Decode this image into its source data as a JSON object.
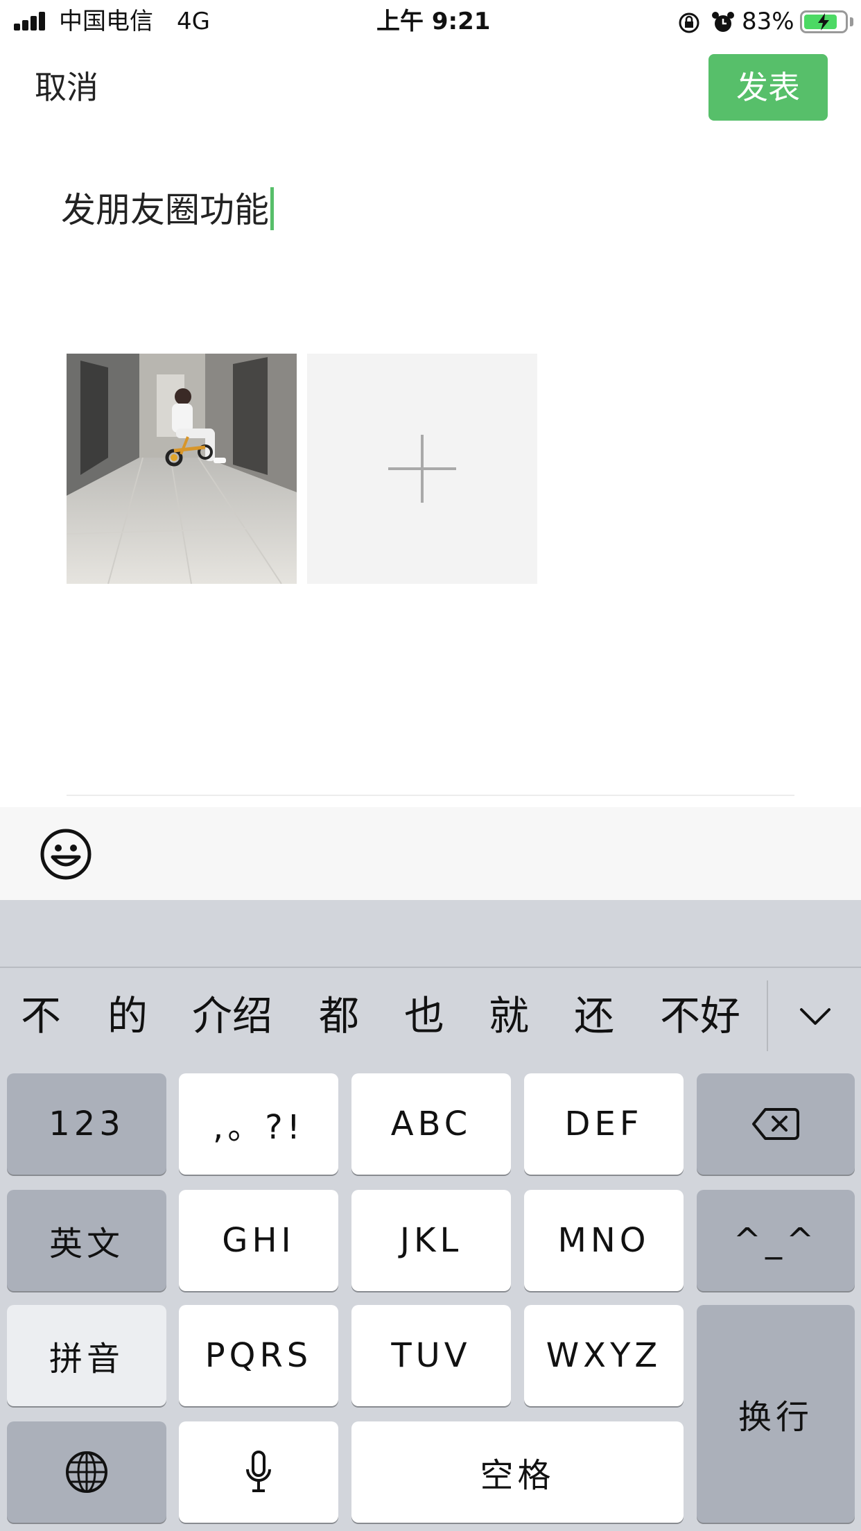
{
  "status_bar": {
    "carrier": "中国电信",
    "network": "4G",
    "time": "上午 9:21",
    "battery_percent": "83%",
    "battery_level": 0.83,
    "icons": [
      "signal-icon",
      "orientation-lock-icon",
      "alarm-icon",
      "battery-charging-icon"
    ]
  },
  "nav": {
    "cancel_label": "取消",
    "publish_label": "发表"
  },
  "post": {
    "text": "发朋友圈功能"
  },
  "photos": {
    "items": [
      {
        "kind": "photo",
        "icon": "photo-thumbnail"
      }
    ],
    "add_icon": "plus-icon"
  },
  "toolbar": {
    "emoji_icon": "smiley-face-icon"
  },
  "keyboard": {
    "candidates": [
      "不",
      "的",
      "介绍",
      "都",
      "也",
      "就",
      "还",
      "不好"
    ],
    "collapse_icon": "chevron-down-icon",
    "rows": [
      [
        "123",
        ",。?!",
        "ABC",
        "DEF",
        "⌫"
      ],
      [
        "英文",
        "GHI",
        "JKL",
        "MNO",
        "^_^"
      ],
      [
        "拼音",
        "PQRS",
        "TUV",
        "WXYZ",
        "换行"
      ],
      [
        "globe",
        "mic",
        "空格"
      ]
    ],
    "labels": {
      "num": "123",
      "punct": ",。?!",
      "abc": "ABC",
      "def": "DEF",
      "english": "英文",
      "ghi": "GHI",
      "jkl": "JKL",
      "mno": "MNO",
      "emoticon": "^_^",
      "pinyin": "拼音",
      "pqrs": "PQRS",
      "tuv": "TUV",
      "wxyz": "WXYZ",
      "return": "换行",
      "space": "空格"
    },
    "key_icons": {
      "delete": "backspace-icon",
      "globe": "globe-icon",
      "mic": "microphone-icon"
    }
  },
  "colors": {
    "accent": "#57bf6a",
    "keyboard_bg": "#d2d5db",
    "dark_key": "#abb0ba",
    "light_key": "#ffffff"
  }
}
